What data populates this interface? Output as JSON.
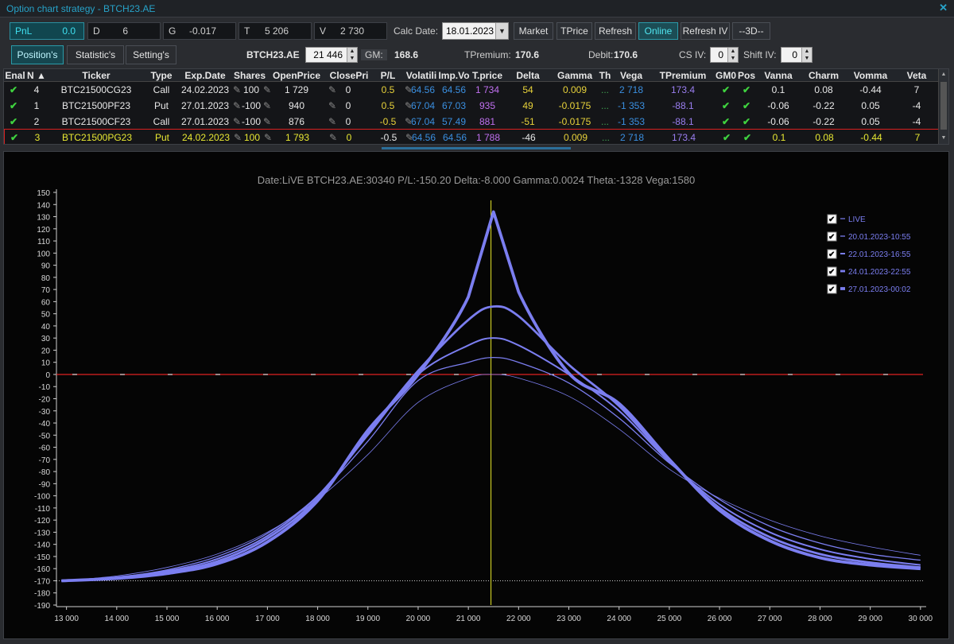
{
  "window": {
    "title": "Option chart strategy - BTCH23.AE",
    "close_glyph": "✕"
  },
  "stats": [
    {
      "key": "PnL",
      "value": "0.0"
    },
    {
      "key": "D",
      "value": "6"
    },
    {
      "key": "G",
      "value": "-0.017"
    },
    {
      "key": "T",
      "value": "5 206"
    },
    {
      "key": "V",
      "value": "2 730"
    }
  ],
  "toolbar": {
    "calc_date_label": "Calc Date:",
    "calc_date": "18.01.2023",
    "market": "Market",
    "tprice": "TPrice",
    "refresh": "Refresh",
    "online": "Online",
    "refresh_iv": "Refresh IV",
    "three_d": "--3D--"
  },
  "tabs": [
    {
      "label": "Position's"
    },
    {
      "label": "Statistic's"
    },
    {
      "label": "Setting's"
    }
  ],
  "info": {
    "instrument": "BTCH23.AE",
    "price": "21 446",
    "gm_label": "GM:",
    "gm": "168.6",
    "tpremium_label": "TPremium:",
    "tpremium": "170.6",
    "debit_label": "Debit:",
    "debit": "170.6",
    "cs_iv_label": "CS IV:",
    "cs_iv": "0",
    "shift_iv_label": "Shift IV:",
    "shift_iv": "0"
  },
  "columns": [
    "Enal",
    "N ▲",
    "Ticker",
    "Type",
    "Exp.Date",
    "Shares",
    "OpenPrice",
    "ClosePri",
    "P/L",
    "Volatili",
    "Imp.Vo",
    "T.price",
    "Delta",
    "Gamma",
    "Th",
    "Vega",
    "TPremium",
    "GM0",
    "Pos",
    "Vanna",
    "Charm",
    "Vomma",
    "Veta"
  ],
  "positions": [
    {
      "n": "4",
      "ticker": "BTC21500CG23",
      "type": "Call",
      "exp": "24.02.2023",
      "shares": "100",
      "open": "1 729",
      "close": "0",
      "pl": "0.5",
      "vol": "64.56",
      "impvol": "64.56",
      "tprice": "1 734",
      "delta": "54",
      "gamma": "0.009",
      "theta": "...",
      "vega": "2 718",
      "tpremium": "173.4",
      "vanna": "0.1",
      "charm": "0.08",
      "vomma": "-0.44",
      "veta": "7"
    },
    {
      "n": "1",
      "ticker": "BTC21500PF23",
      "type": "Put",
      "exp": "27.01.2023",
      "shares": "-100",
      "open": "940",
      "close": "0",
      "pl": "0.5",
      "vol": "67.04",
      "impvol": "67.03",
      "tprice": "935",
      "delta": "49",
      "gamma": "-0.0175",
      "theta": "...",
      "vega": "-1 353",
      "tpremium": "-88.1",
      "vanna": "-0.06",
      "charm": "-0.22",
      "vomma": "0.05",
      "veta": "-4"
    },
    {
      "n": "2",
      "ticker": "BTC21500CF23",
      "type": "Call",
      "exp": "27.01.2023",
      "shares": "-100",
      "open": "876",
      "close": "0",
      "pl": "-0.5",
      "vol": "67.04",
      "impvol": "57.49",
      "tprice": "881",
      "delta": "-51",
      "gamma": "-0.0175",
      "theta": "...",
      "vega": "-1 353",
      "tpremium": "-88.1",
      "vanna": "-0.06",
      "charm": "-0.22",
      "vomma": "0.05",
      "veta": "-4"
    },
    {
      "n": "3",
      "ticker": "BTC21500PG23",
      "type": "Put",
      "exp": "24.02.2023",
      "shares": "100",
      "open": "1 793",
      "close": "0",
      "pl": "-0.5",
      "vol": "64.56",
      "impvol": "64.56",
      "tprice": "1 788",
      "delta": "-46",
      "gamma": "0.009",
      "theta": "...",
      "vega": "2 718",
      "tpremium": "173.4",
      "vanna": "0.1",
      "charm": "0.08",
      "vomma": "-0.44",
      "veta": "7"
    }
  ],
  "colors": {
    "accent": "#2a9aa8",
    "series": "#7b7ef0",
    "zero_line": "#e02020",
    "cursor": "#e8e82a",
    "pl": "#e8d23a",
    "vol": "#3a8fe0",
    "tprice": "#c070f0",
    "delta": "#e8d23a",
    "vega": "#3a8fe0"
  },
  "chart_data": {
    "type": "line",
    "title": "Date:LiVE  BTCH23.AE:30340  P/L:-150.20  Delta:-8.000  Gamma:0.0024  Theta:-1328  Vega:1580",
    "xlim": [
      12800,
      30050
    ],
    "ylim": [
      -190,
      150
    ],
    "xticks": [
      13000,
      14000,
      15000,
      16000,
      17000,
      18000,
      19000,
      20000,
      21000,
      22000,
      23000,
      24000,
      25000,
      26000,
      27000,
      28000,
      29000,
      30000
    ],
    "xtick_labels": [
      "13 000",
      "14 000",
      "15 000",
      "16 000",
      "17 000",
      "18 000",
      "19 000",
      "20 000",
      "21 000",
      "22 000",
      "23 000",
      "24 000",
      "25 000",
      "26 000",
      "27 000",
      "28 000",
      "29 000",
      "30 000"
    ],
    "yticks": [
      150,
      140,
      130,
      120,
      110,
      100,
      90,
      80,
      70,
      60,
      50,
      40,
      30,
      20,
      10,
      0,
      -10,
      -20,
      -30,
      -40,
      -50,
      -60,
      -70,
      -80,
      -90,
      -100,
      -110,
      -120,
      -130,
      -140,
      -150,
      -160,
      -170,
      -180,
      -190
    ],
    "cursor_x": 21450,
    "zero_line_y": 0,
    "floor_line_y": -170,
    "legend_position": "top-right",
    "series": [
      {
        "name": "LIVE",
        "width": 0.8,
        "x": [
          12900,
          14000,
          15000,
          16000,
          17000,
          18000,
          19000,
          20000,
          21000,
          21500,
          22000,
          23000,
          24000,
          25000,
          26000,
          27000,
          28000,
          29000,
          30000
        ],
        "y": [
          -170,
          -166,
          -159,
          -148,
          -130,
          -103,
          -66,
          -23,
          -3,
          0,
          -3,
          -18,
          -45,
          -78,
          -102,
          -120,
          -133,
          -142,
          -149
        ]
      },
      {
        "name": "20.01.2023-10:55",
        "width": 1.3,
        "x": [
          12900,
          14000,
          15000,
          16000,
          17000,
          18000,
          19000,
          20000,
          21000,
          21500,
          22000,
          23000,
          24000,
          25000,
          26000,
          27000,
          28000,
          29000,
          30000
        ],
        "y": [
          -170,
          -167,
          -161,
          -150,
          -131,
          -100,
          -55,
          -5,
          10,
          14,
          10,
          -7,
          -36,
          -73,
          -103,
          -125,
          -139,
          -148,
          -153
        ]
      },
      {
        "name": "22.01.2023-16:55",
        "width": 2.0,
        "x": [
          12900,
          14000,
          15000,
          16000,
          17000,
          18000,
          19000,
          20000,
          21000,
          21500,
          22000,
          23000,
          24000,
          25000,
          26000,
          27000,
          28000,
          29000,
          30000
        ],
        "y": [
          -170,
          -167,
          -162,
          -152,
          -133,
          -100,
          -50,
          0,
          24,
          30,
          24,
          0,
          -30,
          -72,
          -107,
          -130,
          -144,
          -152,
          -157
        ]
      },
      {
        "name": "24.01.2023-22:55",
        "width": 2.8,
        "x": [
          12900,
          14000,
          15000,
          16000,
          17000,
          18000,
          19000,
          20000,
          21000,
          21500,
          22000,
          23000,
          24000,
          25000,
          26000,
          27000,
          28000,
          29000,
          30000
        ],
        "y": [
          -170,
          -168,
          -163,
          -154,
          -135,
          -102,
          -48,
          3,
          45,
          56,
          48,
          8,
          -26,
          -71,
          -110,
          -134,
          -148,
          -155,
          -159
        ]
      },
      {
        "name": "27.01.2023-00:02",
        "width": 3.8,
        "x": [
          12900,
          14000,
          15000,
          16000,
          17000,
          18000,
          19000,
          20000,
          21000,
          21500,
          22000,
          23000,
          24000,
          25000,
          26000,
          27000,
          28000,
          29000,
          30000
        ],
        "y": [
          -170,
          -168,
          -164,
          -156,
          -138,
          -104,
          -46,
          0,
          64,
          134,
          68,
          1,
          -24,
          -70,
          -112,
          -137,
          -151,
          -157,
          -160
        ]
      }
    ]
  }
}
